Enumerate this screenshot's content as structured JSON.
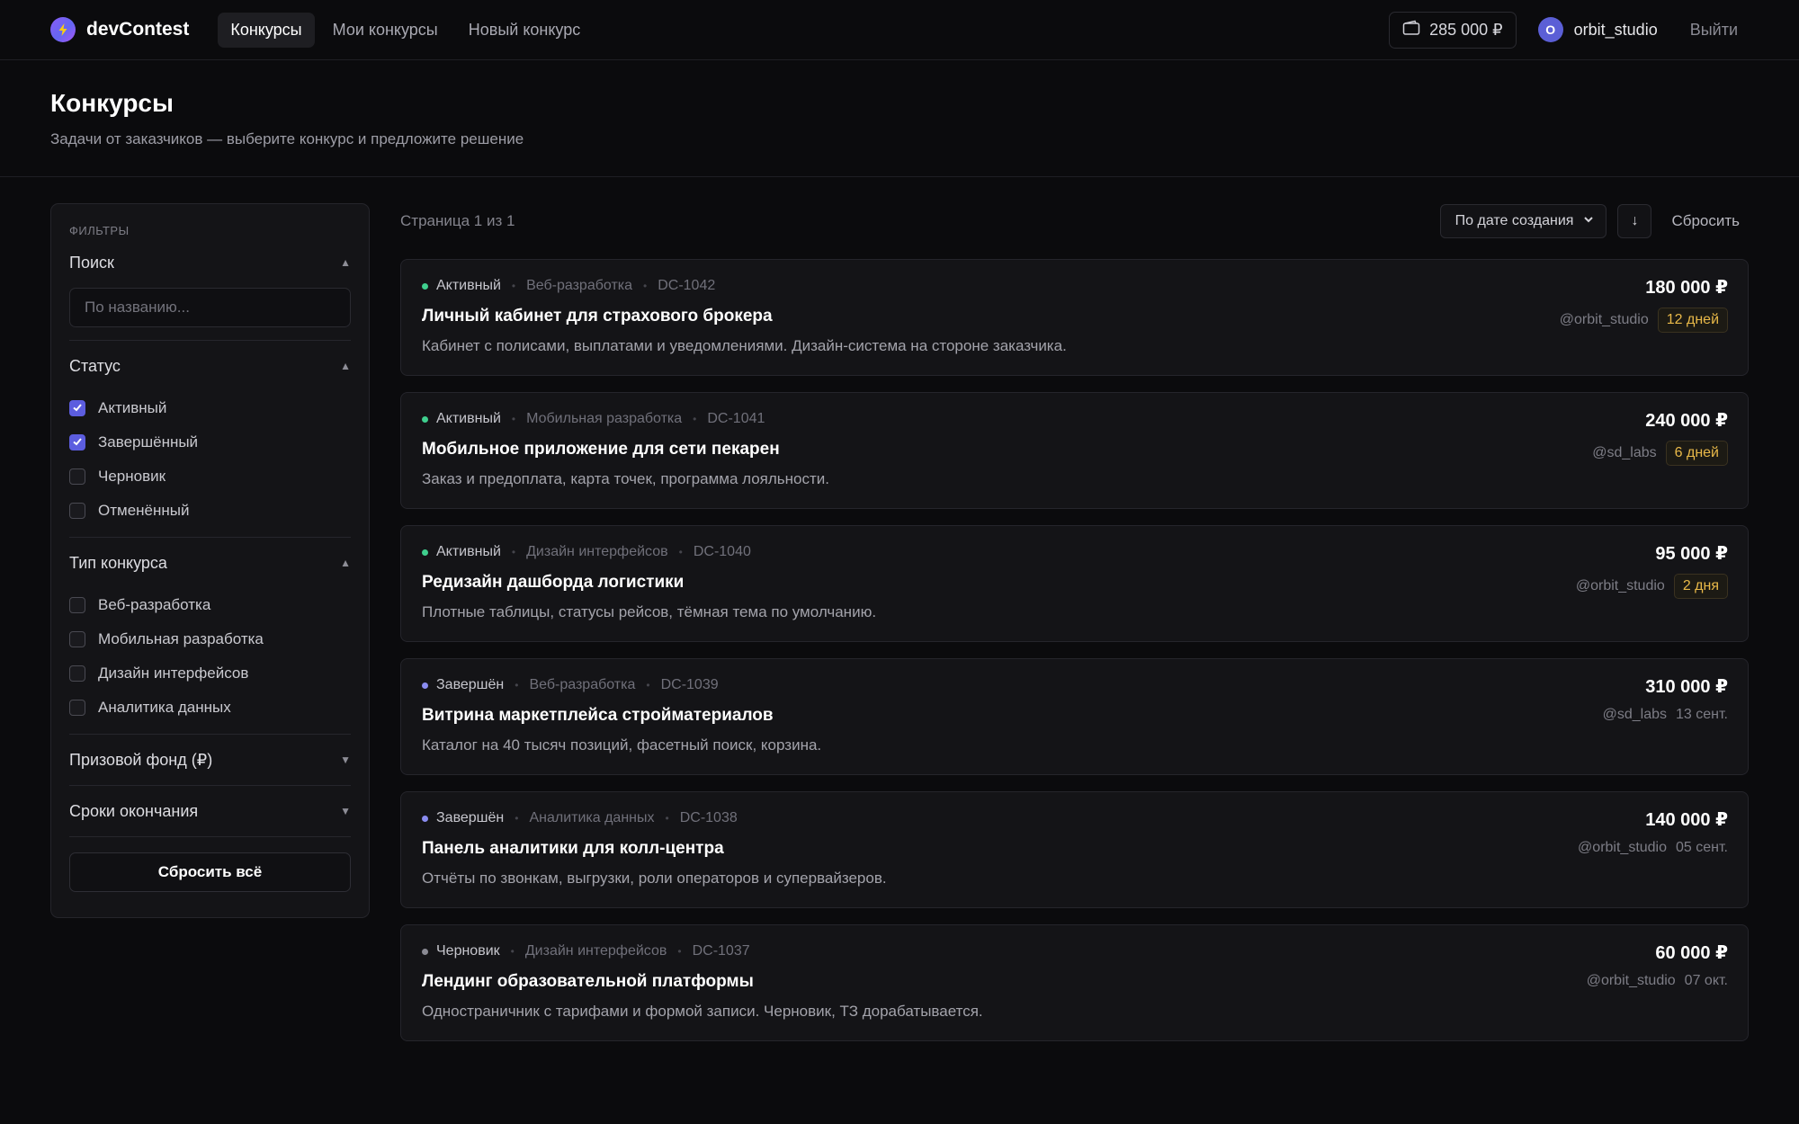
{
  "app": {
    "name": "devContest"
  },
  "nav": [
    {
      "label": "Конкурсы",
      "active": true
    },
    {
      "label": "Мои конкурсы",
      "active": false
    },
    {
      "label": "Новый конкурс",
      "active": false
    }
  ],
  "header_right": {
    "balance": "285 000 ₽",
    "avatar_letter": "O",
    "username": "orbit_studio",
    "logout": "Выйти"
  },
  "page": {
    "title": "Конкурсы",
    "subtitle": "Задачи от заказчиков — выберите конкурс и предложите решение"
  },
  "filters": {
    "title": "ФИЛЬТРЫ",
    "search": {
      "label": "Поиск",
      "placeholder": "По названию..."
    },
    "status": {
      "label": "Статус",
      "options": [
        {
          "label": "Активный",
          "checked": true
        },
        {
          "label": "Завершённый",
          "checked": true
        },
        {
          "label": "Черновик",
          "checked": false
        },
        {
          "label": "Отменённый",
          "checked": false
        }
      ]
    },
    "type": {
      "label": "Тип конкурса",
      "options": [
        {
          "label": "Веб-разработка",
          "checked": false
        },
        {
          "label": "Мобильная разработка",
          "checked": false
        },
        {
          "label": "Дизайн интерфейсов",
          "checked": false
        },
        {
          "label": "Аналитика данных",
          "checked": false
        }
      ]
    },
    "prize": {
      "label": "Призовой фонд (₽)"
    },
    "deadline": {
      "label": "Сроки окончания"
    },
    "reset_all": "Сбросить всё"
  },
  "toolbar": {
    "page_info": "Страница 1 из 1",
    "sort_label": "По дате создания",
    "sort_dir": "↓",
    "reset": "Сбросить"
  },
  "colors": {
    "active": "#3fcf8e",
    "finished": "#8a8cf0",
    "draft": "#8a8a93",
    "badge": "#e9b949"
  },
  "contests": [
    {
      "status": "Активный",
      "status_kind": "active",
      "category": "Веб-разработка",
      "id": "DC-1042",
      "title": "Личный кабинет для страхового брокера",
      "description": "Кабинет с полисами, выплатами и уведомлениями. Дизайн-система на стороне заказчика.",
      "prize": "180 000 ₽",
      "author": "@orbit_studio",
      "deadline": "12 дней",
      "deadline_badge": true
    },
    {
      "status": "Активный",
      "status_kind": "active",
      "category": "Мобильная разработка",
      "id": "DC-1041",
      "title": "Мобильное приложение для сети пекарен",
      "description": "Заказ и предоплата, карта точек, программа лояльности.",
      "prize": "240 000 ₽",
      "author": "@sd_labs",
      "deadline": "6 дней",
      "deadline_badge": true
    },
    {
      "status": "Активный",
      "status_kind": "active",
      "category": "Дизайн интерфейсов",
      "id": "DC-1040",
      "title": "Редизайн дашборда логистики",
      "description": "Плотные таблицы, статусы рейсов, тёмная тема по умолчанию.",
      "prize": "95 000 ₽",
      "author": "@orbit_studio",
      "deadline": "2 дня",
      "deadline_badge": true
    },
    {
      "status": "Завершён",
      "status_kind": "finished",
      "category": "Веб-разработка",
      "id": "DC-1039",
      "title": "Витрина маркетплейса стройматериалов",
      "description": "Каталог на 40 тысяч позиций, фасетный поиск, корзина.",
      "prize": "310 000 ₽",
      "author": "@sd_labs",
      "deadline": "13 сент.",
      "deadline_badge": false
    },
    {
      "status": "Завершён",
      "status_kind": "finished",
      "category": "Аналитика данных",
      "id": "DC-1038",
      "title": "Панель аналитики для колл-центра",
      "description": "Отчёты по звонкам, выгрузки, роли операторов и супервайзеров.",
      "prize": "140 000 ₽",
      "author": "@orbit_studio",
      "deadline": "05 сент.",
      "deadline_badge": false
    },
    {
      "status": "Черновик",
      "status_kind": "draft",
      "category": "Дизайн интерфейсов",
      "id": "DC-1037",
      "title": "Лендинг образовательной платформы",
      "description": "Одностраничник с тарифами и формой записи. Черновик, ТЗ дорабатывается.",
      "prize": "60 000 ₽",
      "author": "@orbit_studio",
      "deadline": "07 окт.",
      "deadline_badge": false
    }
  ]
}
